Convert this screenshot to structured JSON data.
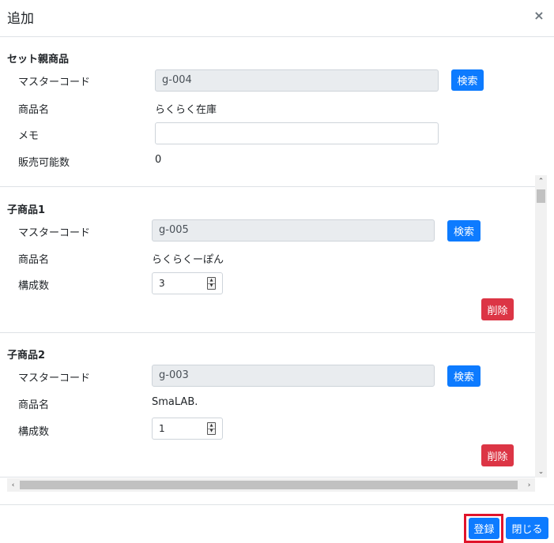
{
  "modal": {
    "title": "追加",
    "close_label": "×"
  },
  "parent": {
    "section_title": "セット親商品",
    "master_code_label": "マスターコード",
    "master_code_value": "g-004",
    "search_label": "検索",
    "product_name_label": "商品名",
    "product_name_value": "らくらく在庫",
    "memo_label": "メモ",
    "memo_value": "",
    "sellable_label": "販売可能数",
    "sellable_value": "0"
  },
  "children": [
    {
      "section_title": "子商品1",
      "master_code_label": "マスターコード",
      "master_code_value": "g-005",
      "search_label": "検索",
      "product_name_label": "商品名",
      "product_name_value": "らくらくーぽん",
      "quantity_label": "構成数",
      "quantity_value": "3",
      "delete_label": "削除"
    },
    {
      "section_title": "子商品2",
      "master_code_label": "マスターコード",
      "master_code_value": "g-003",
      "search_label": "検索",
      "product_name_label": "商品名",
      "product_name_value": "SmaLAB.",
      "quantity_label": "構成数",
      "quantity_value": "1",
      "delete_label": "削除"
    }
  ],
  "footer": {
    "register_label": "登録",
    "close_label": "閉じる"
  },
  "icons": {
    "close": "close-icon",
    "spinner_up": "▲",
    "spinner_down": "▼",
    "scroll_up": "⌃",
    "scroll_down": "⌄",
    "scroll_left": "‹",
    "scroll_right": "›"
  },
  "colors": {
    "primary": "#0d7bff",
    "danger": "#dc3545",
    "highlight": "#e0142b"
  }
}
